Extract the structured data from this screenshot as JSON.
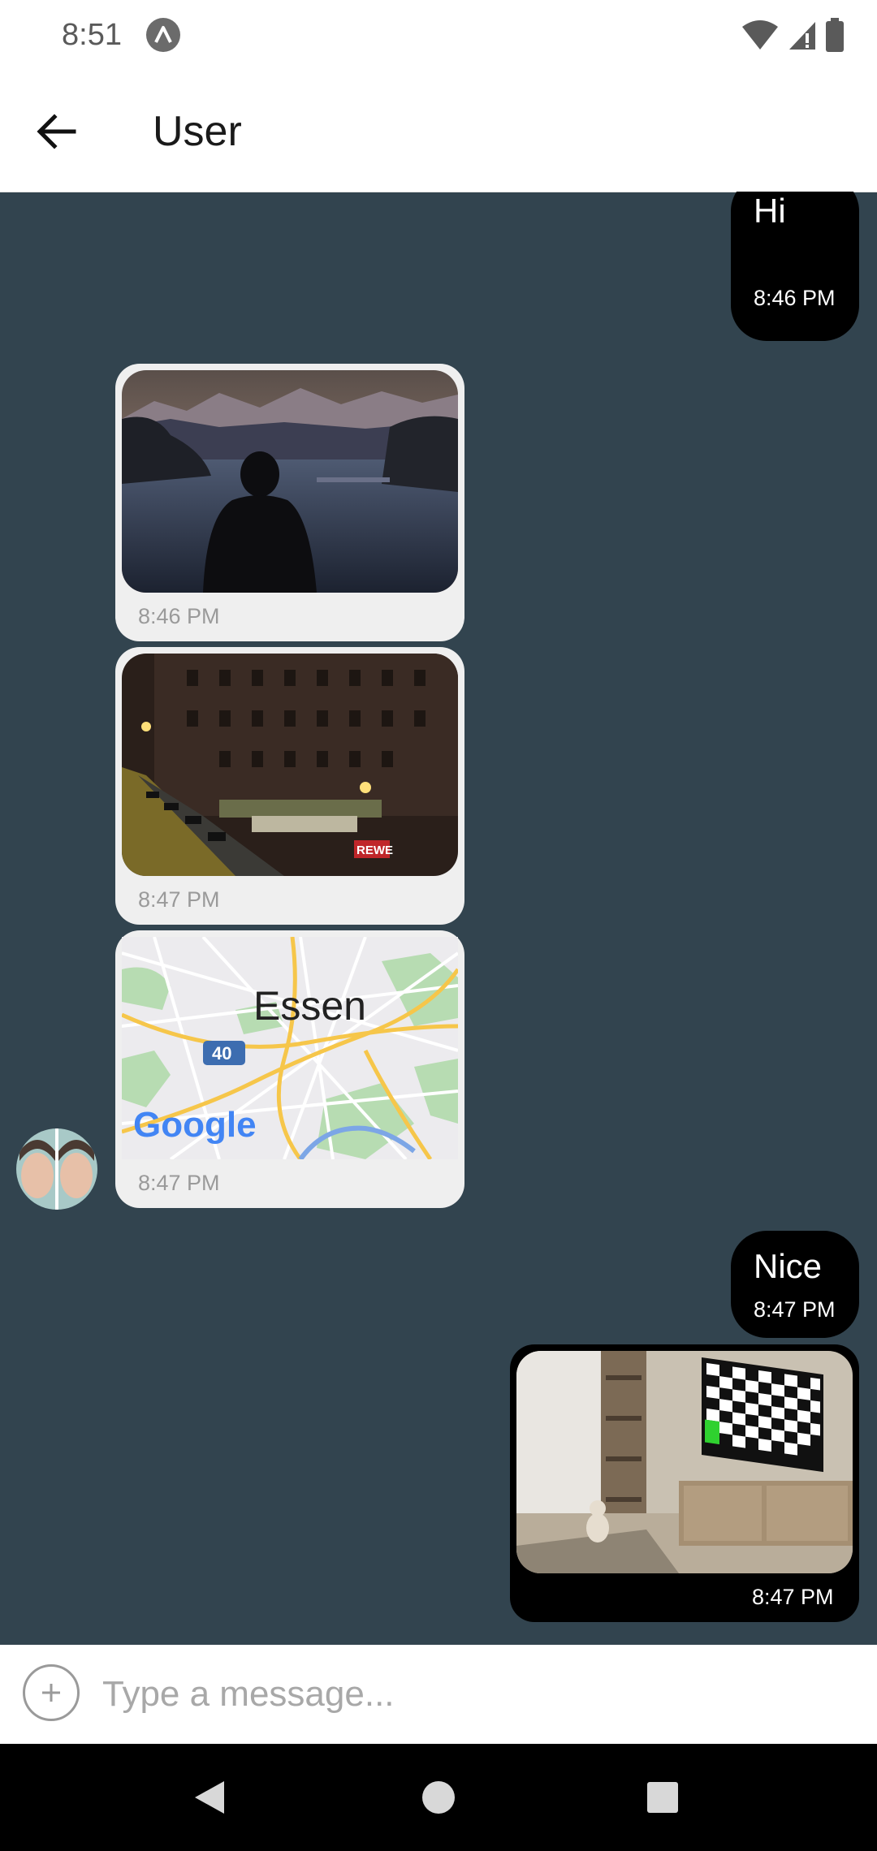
{
  "status_bar": {
    "time": "8:51",
    "icons": [
      "app-notification-icon",
      "wifi-icon",
      "cell-signal-icon",
      "battery-icon"
    ]
  },
  "header": {
    "title": "User",
    "back_icon": "arrow-left-icon"
  },
  "messages": [
    {
      "direction": "out",
      "type": "text",
      "text": "Hi",
      "time": "8:46 PM"
    },
    {
      "direction": "in",
      "type": "image",
      "subject": "person silhouette by mountain lake",
      "time": "8:46 PM"
    },
    {
      "direction": "in",
      "type": "image",
      "subject": "night street with REWE store",
      "sign": "REWE",
      "time": "8:47 PM"
    },
    {
      "direction": "in",
      "type": "location",
      "city": "Essen",
      "road_badge": "40",
      "map_logo": "Google",
      "time": "8:47 PM"
    },
    {
      "direction": "out",
      "type": "text",
      "text": "Nice",
      "time": "8:47 PM"
    },
    {
      "direction": "out",
      "type": "image",
      "subject": "room with TV showing checkerboard",
      "time": "8:47 PM"
    }
  ],
  "composer": {
    "placeholder": "Type a message...",
    "add_icon": "plus-circle-icon"
  },
  "nav_bar": {
    "icons": [
      "back-triangle-icon",
      "home-circle-icon",
      "recents-square-icon"
    ]
  },
  "colors": {
    "chat_background": "#32444f",
    "outgoing_bubble": "#000000",
    "incoming_bubble": "#efefef"
  }
}
